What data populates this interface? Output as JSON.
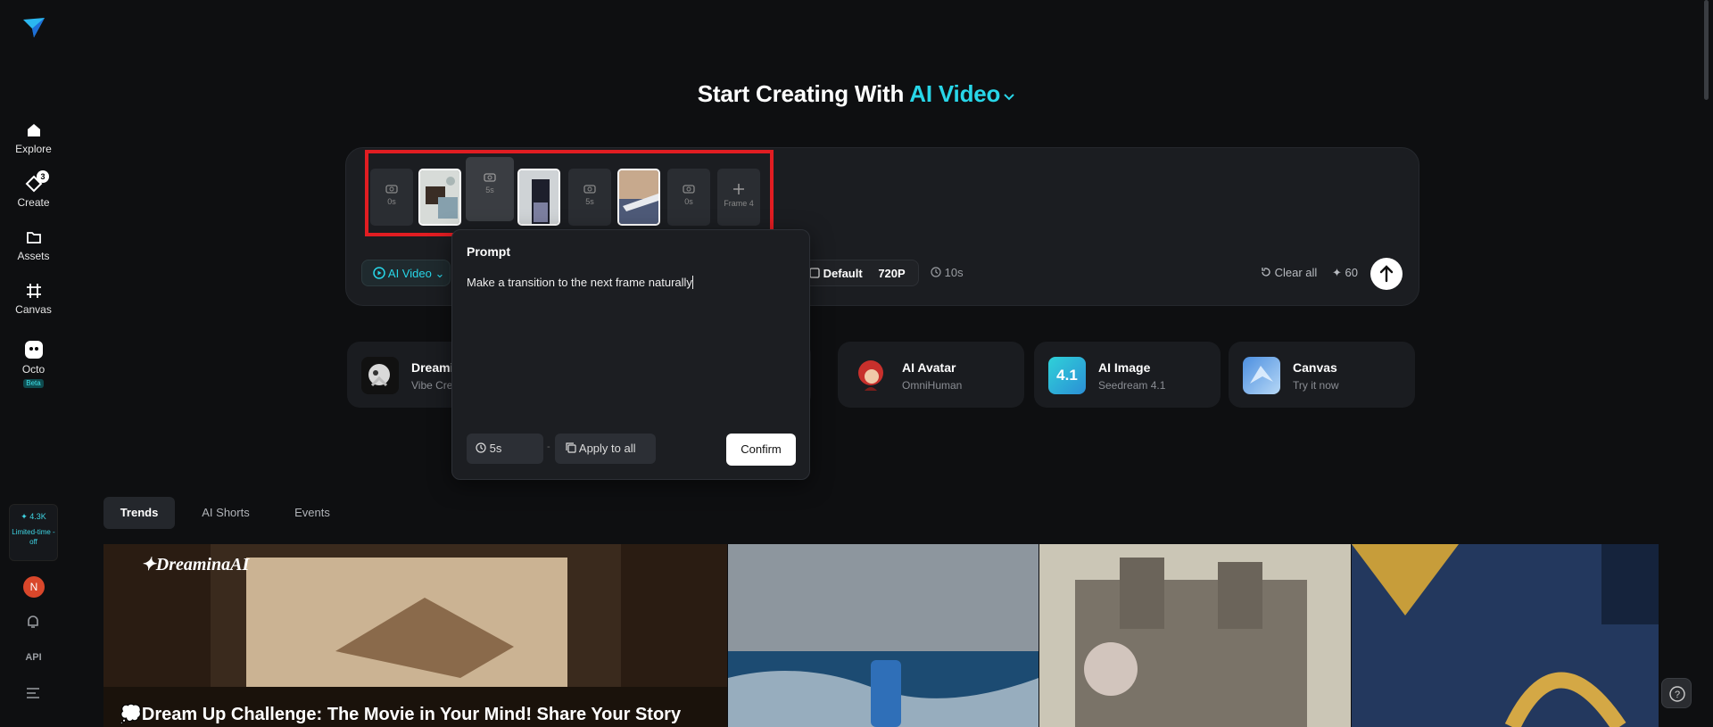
{
  "sidebar": {
    "items": [
      {
        "label": "Explore",
        "icon": "home-icon"
      },
      {
        "label": "Create",
        "icon": "create-icon",
        "badge": "3"
      },
      {
        "label": "Assets",
        "icon": "folder-icon"
      },
      {
        "label": "Canvas",
        "icon": "canvas-icon"
      },
      {
        "label": "Octo",
        "icon": "octo-icon",
        "tag": "Beta"
      }
    ],
    "credits": "✦ 4.3K",
    "promo": "Limited-time - off",
    "avatar_letter": "N",
    "api_label": "API"
  },
  "hero": {
    "title": "Start Creating With ",
    "accent": "AI Video"
  },
  "composer": {
    "frames": [
      {
        "type": "empty",
        "duration": "0s"
      },
      {
        "type": "image",
        "name": "frame-image-1"
      },
      {
        "type": "empty",
        "duration": "5s",
        "selected": true
      },
      {
        "type": "image",
        "name": "frame-image-2"
      },
      {
        "type": "empty",
        "duration": "5s"
      },
      {
        "type": "image",
        "name": "frame-image-3"
      },
      {
        "type": "empty",
        "duration": "0s"
      },
      {
        "type": "add",
        "label": "Frame 4"
      }
    ],
    "mode_label": "AI Video",
    "ratio_label": "Default",
    "resolution": "720P",
    "duration": "10s",
    "clear_label": "Clear all",
    "cost": "60"
  },
  "prompt_popup": {
    "label": "Prompt",
    "text": "Make a transition to the next frame naturally",
    "duration": "5s",
    "separator": "-",
    "apply_label": "Apply to all",
    "confirm_label": "Confirm"
  },
  "tools": [
    {
      "title": "Dreami",
      "subtitle": "Vibe Cre"
    },
    {
      "title": "AI Avatar",
      "subtitle": "OmniHuman"
    },
    {
      "title": "AI Image",
      "subtitle": "Seedream 4.1",
      "icon_text": "4.1"
    },
    {
      "title": "Canvas",
      "subtitle": "Try it now"
    }
  ],
  "tabs": [
    "Trends",
    "AI Shorts",
    "Events"
  ],
  "gallery": {
    "brand": "DreaminaAI",
    "headline": "💭Dream Up Challenge: The Movie in Your Mind! Share Your Story"
  },
  "colors": {
    "accent": "#28d6e8",
    "highlight_box": "#e11d22",
    "background": "#0e0f11"
  }
}
